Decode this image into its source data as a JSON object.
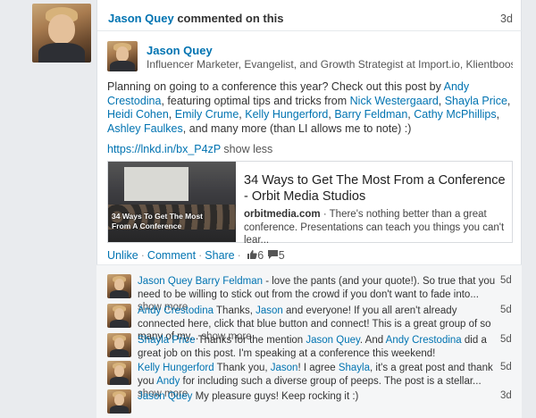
{
  "activity": {
    "actor": "Jason Quey",
    "verb": "commented on this",
    "time": "3d"
  },
  "post": {
    "author": "Jason Quey",
    "headline": "Influencer Marketer, Evangelist, and Growth Strategist at Import.io, Klientboost, ...",
    "body": {
      "t1": "Planning on going to a conference this year? Check out this post by ",
      "m1": "Andy Crestodina",
      "t2": ", featuring optimal tips and tricks from ",
      "m2": "Nick Westergaard",
      "c1": ", ",
      "m3": "Shayla Price",
      "c2": ", ",
      "m4": "Heidi Cohen",
      "c3": ", ",
      "m5": "Emily Crume",
      "c4": ", ",
      "m6": "Kelly Hungerford",
      "c5": ", ",
      "m7": "Barry Feldman",
      "c6": ", ",
      "m8": "Cathy McPhillips",
      "c7": ", ",
      "m9": "Ashley Faulkes",
      "t3": ", and many more (than LI allows me to note) :)"
    },
    "shortlink": "https://lnkd.in/bx_P4zP",
    "show_less": "show less",
    "preview": {
      "title": "34 Ways to Get The Most From a Conference - Orbit Media Studios",
      "domain": "orbitmedia.com",
      "separator": " · ",
      "snippet": "There's nothing better than a great conference. Presentations can teach you things you can't lear...",
      "thumb_caption_1": "34 Ways To Get The Most",
      "thumb_caption_2": "From A Conference"
    },
    "actions": {
      "unlike": "Unlike",
      "comment": "Comment",
      "share": "Share",
      "likes": "6",
      "comments": "5"
    }
  },
  "comments": [
    {
      "name": "Jason Quey",
      "parts": [
        {
          "t": "Barry Feldman",
          "link": true
        },
        {
          "t": " - love the pants (and your quote!). So true that you need to be willing to stick out from the crowd if you don't want to fade into... ",
          "link": false
        }
      ],
      "more": "show more",
      "time": "5d"
    },
    {
      "name": "Andy Crestodina",
      "parts": [
        {
          "t": "Thanks, ",
          "link": false
        },
        {
          "t": "Jason",
          "link": true
        },
        {
          "t": " and everyone! If you all aren't already connected here, click that blue button and connect! This is a great group of so many of my... ",
          "link": false
        }
      ],
      "more": "show more",
      "time": "5d"
    },
    {
      "name": "Shayla Price",
      "parts": [
        {
          "t": "Thanks for the mention ",
          "link": false
        },
        {
          "t": "Jason Quey",
          "link": true
        },
        {
          "t": ". And ",
          "link": false
        },
        {
          "t": "Andy Crestodina",
          "link": true
        },
        {
          "t": " did a great job on this post. I'm speaking at a conference this weekend!",
          "link": false
        }
      ],
      "more": "",
      "time": "5d"
    },
    {
      "name": "Kelly Hungerford",
      "parts": [
        {
          "t": "Thank you, ",
          "link": false
        },
        {
          "t": "Jason",
          "link": true
        },
        {
          "t": "! I agree ",
          "link": false
        },
        {
          "t": "Shayla",
          "link": true
        },
        {
          "t": ", it's a great post and thank you ",
          "link": false
        },
        {
          "t": "Andy",
          "link": true
        },
        {
          "t": " for including such a diverse group of peeps. The post is a stellar... ",
          "link": false
        }
      ],
      "more": "show more",
      "time": "5d"
    },
    {
      "name": "Jason Quey",
      "parts": [
        {
          "t": "My pleasure guys! Keep rocking it :)",
          "link": false
        }
      ],
      "more": "",
      "time": "3d"
    }
  ],
  "colors": {
    "link": "#0073b1",
    "background": "#e9ebee",
    "card": "#ffffff",
    "comments_bg": "#f5f6f7"
  },
  "icons": {
    "like": "thumbs-up-icon",
    "comment": "speech-bubble-icon"
  }
}
